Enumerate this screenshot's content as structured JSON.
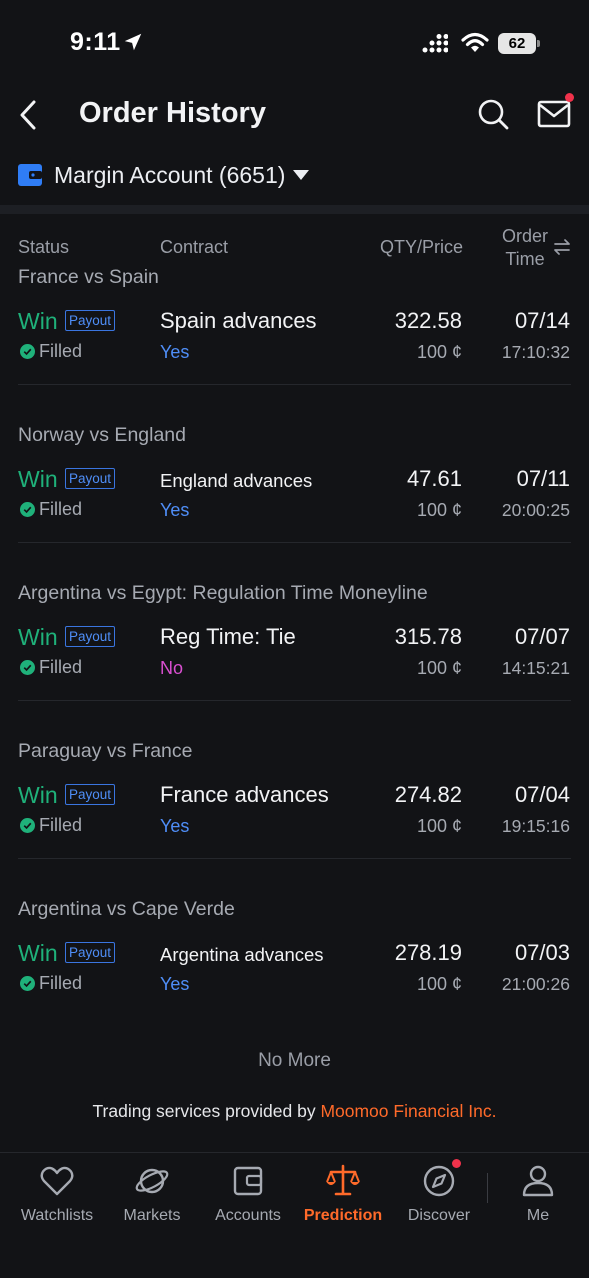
{
  "status_bar": {
    "time": "9:11",
    "battery": "62"
  },
  "header": {
    "title": "Order History"
  },
  "account": {
    "label": "Margin Account (6651)"
  },
  "columns": {
    "status": "Status",
    "contract": "Contract",
    "qty_price": "QTY/Price",
    "order_time_1": "Order",
    "order_time_2": "Time"
  },
  "orders": [
    {
      "match": "France vs Spain",
      "result": "Win",
      "payout": "Payout",
      "state": "Filled",
      "contract": "Spain advances",
      "side": "Yes",
      "qty": "322.58",
      "price": "100 ¢",
      "date": "07/14",
      "time": "17:10:32"
    },
    {
      "match": "Norway vs England",
      "result": "Win",
      "payout": "Payout",
      "state": "Filled",
      "contract": "England advances",
      "side": "Yes",
      "qty": "47.61",
      "price": "100 ¢",
      "date": "07/11",
      "time": "20:00:25"
    },
    {
      "match": "Argentina vs Egypt: Regulation Time Moneyline",
      "result": "Win",
      "payout": "Payout",
      "state": "Filled",
      "contract": "Reg Time: Tie",
      "side": "No",
      "qty": "315.78",
      "price": "100 ¢",
      "date": "07/07",
      "time": "14:15:21"
    },
    {
      "match": "Paraguay vs France",
      "result": "Win",
      "payout": "Payout",
      "state": "Filled",
      "contract": "France advances",
      "side": "Yes",
      "qty": "274.82",
      "price": "100 ¢",
      "date": "07/04",
      "time": "19:15:16"
    },
    {
      "match": "Argentina vs Cape Verde",
      "result": "Win",
      "payout": "Payout",
      "state": "Filled",
      "contract": "Argentina advances",
      "side": "Yes",
      "qty": "278.19",
      "price": "100 ¢",
      "date": "07/03",
      "time": "21:00:26"
    }
  ],
  "footer": {
    "no_more": "No More",
    "provider_prefix": "Trading services provided by ",
    "provider_name": "Moomoo Financial Inc."
  },
  "tabs": [
    {
      "label": "Watchlists",
      "icon": "heart-icon"
    },
    {
      "label": "Markets",
      "icon": "planet-icon"
    },
    {
      "label": "Accounts",
      "icon": "wallet-icon"
    },
    {
      "label": "Prediction",
      "icon": "scale-icon",
      "active": true
    },
    {
      "label": "Discover",
      "icon": "compass-icon"
    },
    {
      "label": "Me",
      "icon": "person-icon"
    }
  ],
  "colors": {
    "accent": "#ff6a2a",
    "win": "#1fb17a",
    "yes": "#4f8ef7",
    "no": "#d94fd0",
    "badge": "#f0324b"
  }
}
